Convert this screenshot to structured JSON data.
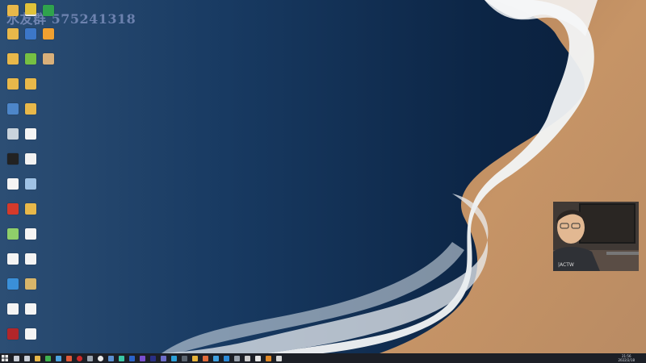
{
  "watermark": "水友群 575241318",
  "desktop_icons": [
    {
      "label": "",
      "icon": "folder-icon",
      "color": "#e8b84a"
    },
    {
      "label": "",
      "icon": "panda-icon",
      "color": "#f2f2f2"
    },
    {
      "label": "",
      "icon": "app-icon",
      "color": "#2fa34d"
    },
    {
      "label": "",
      "icon": "folder-icon",
      "color": "#e8b84a"
    },
    {
      "label": "",
      "icon": "mp-icon",
      "color": "#3c77c8"
    },
    {
      "label": "",
      "icon": "warning-icon",
      "color": "#f0a030"
    },
    {
      "label": "",
      "icon": "folder-icon",
      "color": "#e8b84a"
    },
    {
      "label": "",
      "icon": "globe-icon",
      "color": "#76c043"
    },
    {
      "label": "",
      "icon": "avatar-icon",
      "color": "#d9b07a"
    },
    {
      "label": "",
      "icon": "folder-icon",
      "color": "#e8b84a"
    },
    {
      "label": "",
      "icon": "folder-icon",
      "color": "#e8b84a"
    },
    {
      "label": "",
      "icon": "window-icon",
      "color": "#4d86c9"
    },
    {
      "label": "",
      "icon": "folder-icon",
      "color": "#e8b84a"
    },
    {
      "label": "",
      "icon": "recycle-bin-icon",
      "color": "#c8d3dc"
    },
    {
      "label": "",
      "icon": "file-icon",
      "color": "#f4f4f4"
    },
    {
      "label": "",
      "icon": "document-icon",
      "color": "#222222"
    },
    {
      "label": "",
      "icon": "disc-icon",
      "color": "#f2f2f2"
    },
    {
      "label": "",
      "icon": "file-icon",
      "color": "#f4f4f4"
    },
    {
      "label": "",
      "icon": "shortcut-icon",
      "color": "#9fc2e5"
    },
    {
      "label": "",
      "icon": "red-app-icon",
      "color": "#d53a2a"
    },
    {
      "label": "",
      "icon": "folder-icon",
      "color": "#e8b84a"
    },
    {
      "label": "",
      "icon": "leaf-icon",
      "color": "#8fcf6a"
    },
    {
      "label": "",
      "icon": "file-icon",
      "color": "#f4f4f4"
    },
    {
      "label": "",
      "icon": "file-icon",
      "color": "#f4f4f4"
    },
    {
      "label": "",
      "icon": "file-icon",
      "color": "#f4f4f4"
    },
    {
      "label": "",
      "icon": "plane-icon",
      "color": "#3a8fd8"
    },
    {
      "label": "",
      "icon": "book-icon",
      "color": "#d7b56a"
    },
    {
      "label": "",
      "icon": "file-icon",
      "color": "#f4f4f4"
    },
    {
      "label": "",
      "icon": "file-icon",
      "color": "#f4f4f4"
    },
    {
      "label": "",
      "icon": "game-icon",
      "color": "#b2262a"
    },
    {
      "label": "",
      "icon": "file-icon",
      "color": "#f4f4f4"
    },
    {
      "label": "",
      "icon": "gear-icon",
      "color": "#e0c23a"
    }
  ],
  "taskbar": {
    "start_icon": "windows-logo-icon",
    "apps": [
      {
        "icon": "search-icon",
        "color": "#c9ced6"
      },
      {
        "icon": "task-view-icon",
        "color": "#c9ced6"
      },
      {
        "icon": "folder-icon",
        "color": "#e8b84a"
      },
      {
        "icon": "chat-icon",
        "color": "#3fb34f"
      },
      {
        "icon": "app-icon",
        "color": "#4da3e0"
      },
      {
        "icon": "media-icon",
        "color": "#e05a3a"
      },
      {
        "icon": "circle-icon",
        "color": "#cc2a2a"
      },
      {
        "icon": "app-icon",
        "color": "#9aa3ae"
      },
      {
        "icon": "browser-icon",
        "color": "#e9e9e9"
      },
      {
        "icon": "app-icon",
        "color": "#5a8fd0"
      },
      {
        "icon": "app-icon",
        "color": "#3ac6a6"
      },
      {
        "icon": "app-icon",
        "color": "#2b63c9"
      },
      {
        "icon": "app-icon",
        "color": "#7a4fd0"
      },
      {
        "icon": "app-icon",
        "color": "#2a2f86"
      },
      {
        "icon": "app-icon",
        "color": "#6c6cc9"
      },
      {
        "icon": "app-icon",
        "color": "#2b9fd8"
      },
      {
        "icon": "app-icon",
        "color": "#5b6570"
      },
      {
        "icon": "app-icon",
        "color": "#e6b23a"
      },
      {
        "icon": "app-icon",
        "color": "#e06a3a"
      },
      {
        "icon": "app-icon",
        "color": "#40a0e0"
      },
      {
        "icon": "app-icon",
        "color": "#2c8bd8"
      },
      {
        "icon": "app-icon",
        "color": "#9aa3ae"
      },
      {
        "icon": "app-icon",
        "color": "#cfcfcf"
      },
      {
        "icon": "app-icon",
        "color": "#e6e6e6"
      },
      {
        "icon": "app-icon",
        "color": "#e08a2a"
      },
      {
        "icon": "check-icon",
        "color": "#d8d8d8"
      }
    ],
    "tray": {
      "time": "21:56",
      "date": "2022/2/18"
    }
  },
  "colors": {
    "ocean": "#123259",
    "foam": "#f2f4f5",
    "sand": "#c69466",
    "taskbar": "#1c1f26"
  }
}
